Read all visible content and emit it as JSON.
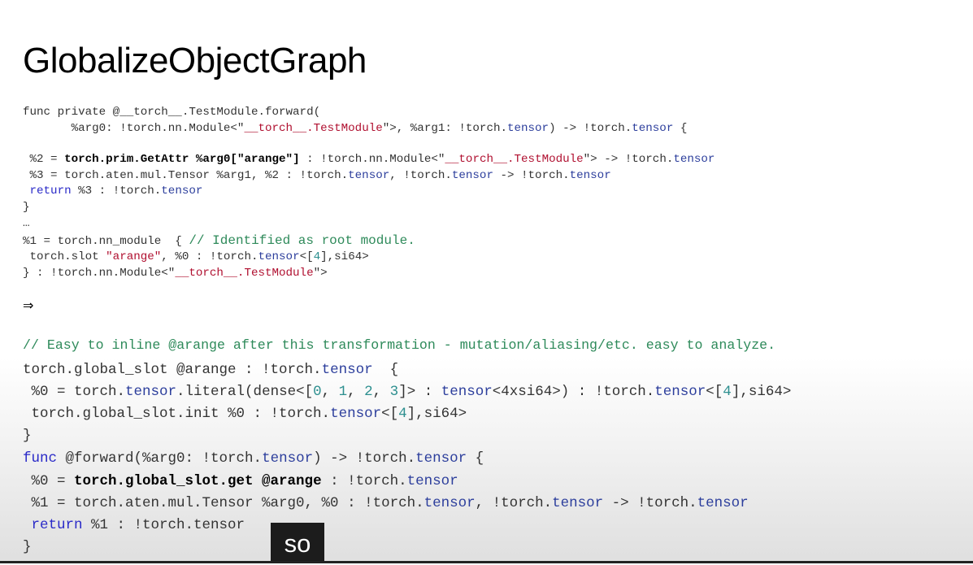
{
  "slide": {
    "title": "GlobalizeObjectGraph",
    "before": {
      "l1": "func private @__torch__.TestModule.forward(",
      "l2a": "       %arg0: !torch.nn.Module<\"",
      "l2b": "__torch__.TestModule",
      "l2c": "\">, %arg1: !torch.",
      "l2d": "tensor",
      "l2e": ") -> !torch.",
      "l2f": "tensor",
      "l2g": " {",
      "l3a": " %2 = ",
      "l3b": "torch.prim.GetAttr %arg0[",
      "l3c": "\"arange\"",
      "l3d": "]",
      "l3e": " : !torch.nn.Module<\"",
      "l3f": "__torch__.TestModule",
      "l3g": "\"> -> !torch.",
      "l3h": "tensor",
      "l4a": " %3 = torch.aten.mul.Tensor %arg1, %2 : !torch.",
      "l4b": "tensor",
      "l4c": ", !torch.",
      "l4d": "tensor",
      "l4e": " -> !torch.",
      "l4f": "tensor",
      "l5a": " return",
      "l5b": " %3 : !torch.",
      "l5c": "tensor",
      "l6": "}",
      "l7": "…",
      "l8a": "%1 = torch.nn_module  { ",
      "l8b": "// Identified as root module.",
      "l9a": " torch.slot ",
      "l9b": "\"arange\"",
      "l9c": ", %0 : !torch.",
      "l9d": "tensor",
      "l9e": "<[",
      "l9f": "4",
      "l9g": "],si64>",
      "l10a": "} : !torch.nn.Module<\"",
      "l10b": "__torch__.TestModule",
      "l10c": "\">"
    },
    "arrow": "⇒",
    "after": {
      "comment": "// Easy to inline @arange after this transformation - mutation/aliasing/etc. easy to analyze.",
      "m1a": "torch.global_slot @arange : !torch.",
      "m1b": "tensor",
      "m1c": "  {",
      "m2a": " %0 = torch.",
      "m2b": "tensor",
      "m2c": ".literal(dense<[",
      "m2d": "0",
      "m2e": ", ",
      "m2f": "1",
      "m2g": ", ",
      "m2h": "2",
      "m2i": ", ",
      "m2j": "3",
      "m2k": "]> : ",
      "m2l": "tensor",
      "m2m": "<4xsi64>) : !torch.",
      "m2n": "tensor",
      "m2o": "<[",
      "m2p": "4",
      "m2q": "],si64>",
      "m3a": " torch.global_slot.init %0 : !torch.",
      "m3b": "tensor",
      "m3c": "<[",
      "m3d": "4",
      "m3e": "],si64>",
      "m4": "}",
      "f1a": "func",
      "f1b": " @forward(%arg0: !torch.",
      "f1c": "tensor",
      "f1d": ") -> !torch.",
      "f1e": "tensor",
      "f1f": " {",
      "f2a": " %0 = ",
      "f2b": "torch.global_slot.get @arange",
      "f2c": " : !torch.",
      "f2d": "tensor",
      "f3a": " %1 = torch.aten.mul.Tensor %arg0, %0 : !torch.",
      "f3b": "tensor",
      "f3c": ", !torch.",
      "f3d": "tensor",
      "f3e": " -> !torch.",
      "f3f": "tensor",
      "f4a": " return",
      "f4b": " %1 : !torch.tensor",
      "f5": "}"
    },
    "caption": "so"
  }
}
